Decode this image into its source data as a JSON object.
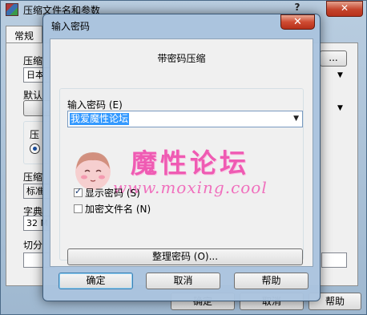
{
  "back_window": {
    "title": "压缩文件名和参数",
    "help_symbol": "?",
    "close_symbol": "✕",
    "tab_general": "常规",
    "label_format_fragment": "压缩",
    "value_profile_fragment": "日本",
    "label_default_fragment": "默认",
    "label_method_fragment": "压",
    "label_mode_fragment": "压缩",
    "value_mode_fragment": "标准",
    "label_dict_fragment": "字典",
    "value_dict_fragment": "32 M",
    "label_split_fragment": "切分",
    "browse_fragment": "...",
    "btn_ok_fragment": "确定",
    "btn_cancel_fragment": "取消",
    "btn_help_fragment": "帮助"
  },
  "dialog": {
    "title": "输入密码",
    "close_symbol": "✕",
    "subtitle": "带密码压缩",
    "password_label": "输入密码 (E)",
    "password_value": "我爱魔性论坛",
    "show_password_label": "显示密码 (S)",
    "show_password_checked": true,
    "encrypt_names_label": "加密文件名 (N)",
    "encrypt_names_checked": false,
    "organize_button": "整理密码 (O)...",
    "ok_button": "确定",
    "cancel_button": "取消",
    "help_button": "帮助"
  },
  "watermark": {
    "brand": "魔性论坛",
    "url": "www.moxing.cool"
  },
  "colors": {
    "selection": "#3399ff",
    "watermark_pink": "#ef5bb3",
    "close_red": "#c4442c"
  }
}
